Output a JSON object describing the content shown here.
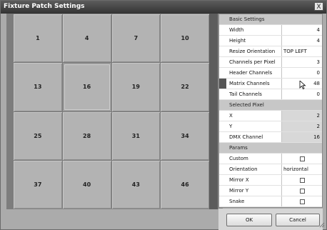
{
  "window": {
    "title": "Fixture Patch Settings",
    "close_glyph": "X"
  },
  "grid": {
    "cells": [
      "1",
      "4",
      "7",
      "10",
      "13",
      "16",
      "19",
      "22",
      "25",
      "28",
      "31",
      "34",
      "37",
      "40",
      "43",
      "46"
    ],
    "selected_index": 5
  },
  "panel": {
    "basic": {
      "header": "Basic Settings",
      "width": {
        "label": "Width",
        "value": "4"
      },
      "height": {
        "label": "Height",
        "value": "4"
      },
      "resize_orientation": {
        "label": "Resize Orientation",
        "value": "TOP LEFT"
      },
      "channels_per_pixel": {
        "label": "Channels per Pixel",
        "value": "3"
      },
      "header_channels": {
        "label": "Header Channels",
        "value": "0"
      },
      "matrix_channels": {
        "label": "Matrix Channels",
        "value": "48"
      },
      "tail_channels": {
        "label": "Tail Channels",
        "value": "0"
      }
    },
    "selected": {
      "header": "Selected Pixel",
      "x": {
        "label": "X",
        "value": "2"
      },
      "y": {
        "label": "Y",
        "value": "2"
      },
      "dmx_channel": {
        "label": "DMX Channel",
        "value": "16"
      }
    },
    "params": {
      "header": "Params",
      "custom": {
        "label": "Custom",
        "checked": false
      },
      "orientation": {
        "label": "Orientation",
        "value": "horizontal"
      },
      "mirror_x": {
        "label": "Mirror X",
        "checked": false
      },
      "mirror_y": {
        "label": "Mirror Y",
        "checked": false
      },
      "snake": {
        "label": "Snake",
        "checked": false
      }
    }
  },
  "buttons": {
    "ok": "OK",
    "cancel": "Cancel"
  },
  "icons": {
    "close": "close-icon",
    "cursor": "mouse-pointer-icon",
    "grip": "resize-grip-icon"
  }
}
